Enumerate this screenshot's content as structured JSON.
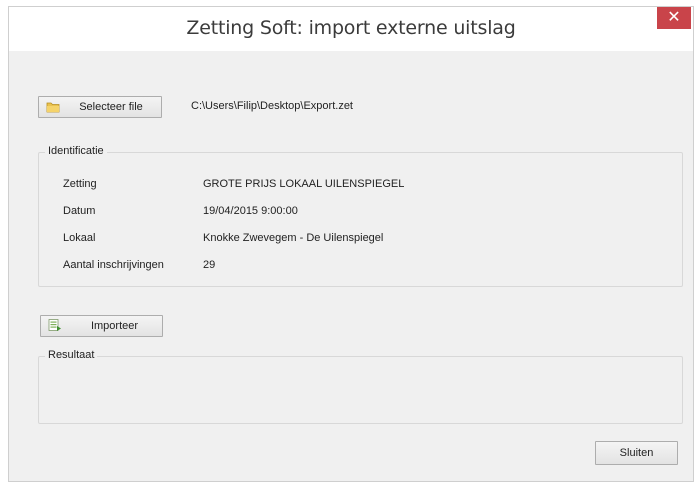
{
  "window": {
    "title": "Zetting Soft: import externe uitslag",
    "close_glyph": "✕"
  },
  "file": {
    "button_label": "Selecteer file",
    "button_icon": "folder-icon",
    "path": "C:\\Users\\Filip\\Desktop\\Export.zet"
  },
  "identification": {
    "legend": "Identificatie",
    "fields": [
      {
        "label": "Zetting",
        "value": "GROTE PRIJS LOKAAL UILENSPIEGEL"
      },
      {
        "label": "Datum",
        "value": "19/04/2015 9:00:00"
      },
      {
        "label": "Lokaal",
        "value": "Knokke Zwevegem - De Uilenspiegel"
      },
      {
        "label": "Aantal inschrijvingen",
        "value": "29"
      }
    ]
  },
  "import": {
    "button_label": "Importeer",
    "button_icon": "import-sheet-icon"
  },
  "result": {
    "legend": "Resultaat"
  },
  "footer": {
    "close_label": "Sluiten"
  },
  "colors": {
    "close_button": "#c9444a",
    "window_bg": "#f0f0f0",
    "titlebar_bg": "#ffffff"
  }
}
